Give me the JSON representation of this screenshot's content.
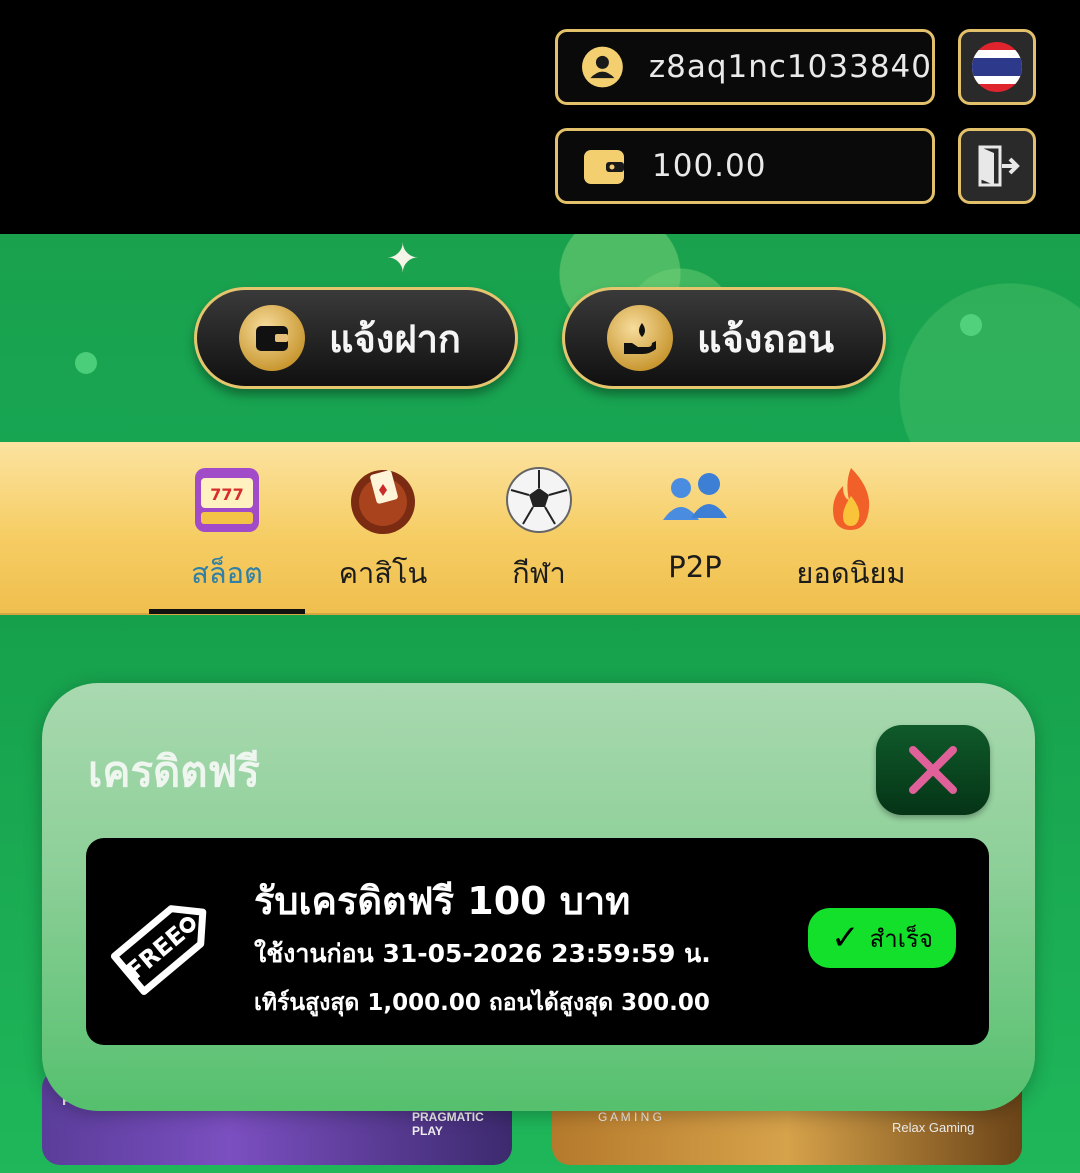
{
  "header": {
    "username": "z8aq1nc1033840",
    "balance": "100.00",
    "user_icon": "user-circle-icon",
    "wallet_icon": "wallet-icon",
    "flag_icon": "thai-flag-icon",
    "logout_icon": "logout-icon"
  },
  "actions": {
    "deposit_label": "แจ้งฝาก",
    "withdraw_label": "แจ้งถอน"
  },
  "categories": [
    {
      "label": "สล็อต",
      "icon": "slot-machine-icon",
      "active": true
    },
    {
      "label": "คาสิโน",
      "icon": "casino-chip-icon",
      "active": false
    },
    {
      "label": "กีฬา",
      "icon": "soccer-ball-icon",
      "active": false
    },
    {
      "label": "P2P",
      "icon": "people-icon",
      "active": false
    },
    {
      "label": "ยอดนิยม",
      "icon": "fire-icon",
      "active": false
    }
  ],
  "games": {
    "left_provider": "PRAGMATIC PLAY",
    "left_partial": "PRA",
    "right_provider": "Relax Gaming",
    "right_partial": "G A M I N G"
  },
  "modal": {
    "title": "เครดิตฟรี",
    "promo": {
      "tag_icon": "free-tag-icon",
      "title": "รับเครดิตฟรี 100 บาท",
      "expiry": "ใช้งานก่อน 31-05-2026 23:59:59 น.",
      "limits": "เทิร์นสูงสุด 1,000.00 ถอนได้สูงสุด 300.00",
      "status_label": "สำเร็จ",
      "status_check": "✓"
    }
  },
  "colors": {
    "accent_gold": "#e3c06a",
    "status_green": "#12e02a",
    "active_tab_text": "#2f7fa6"
  }
}
